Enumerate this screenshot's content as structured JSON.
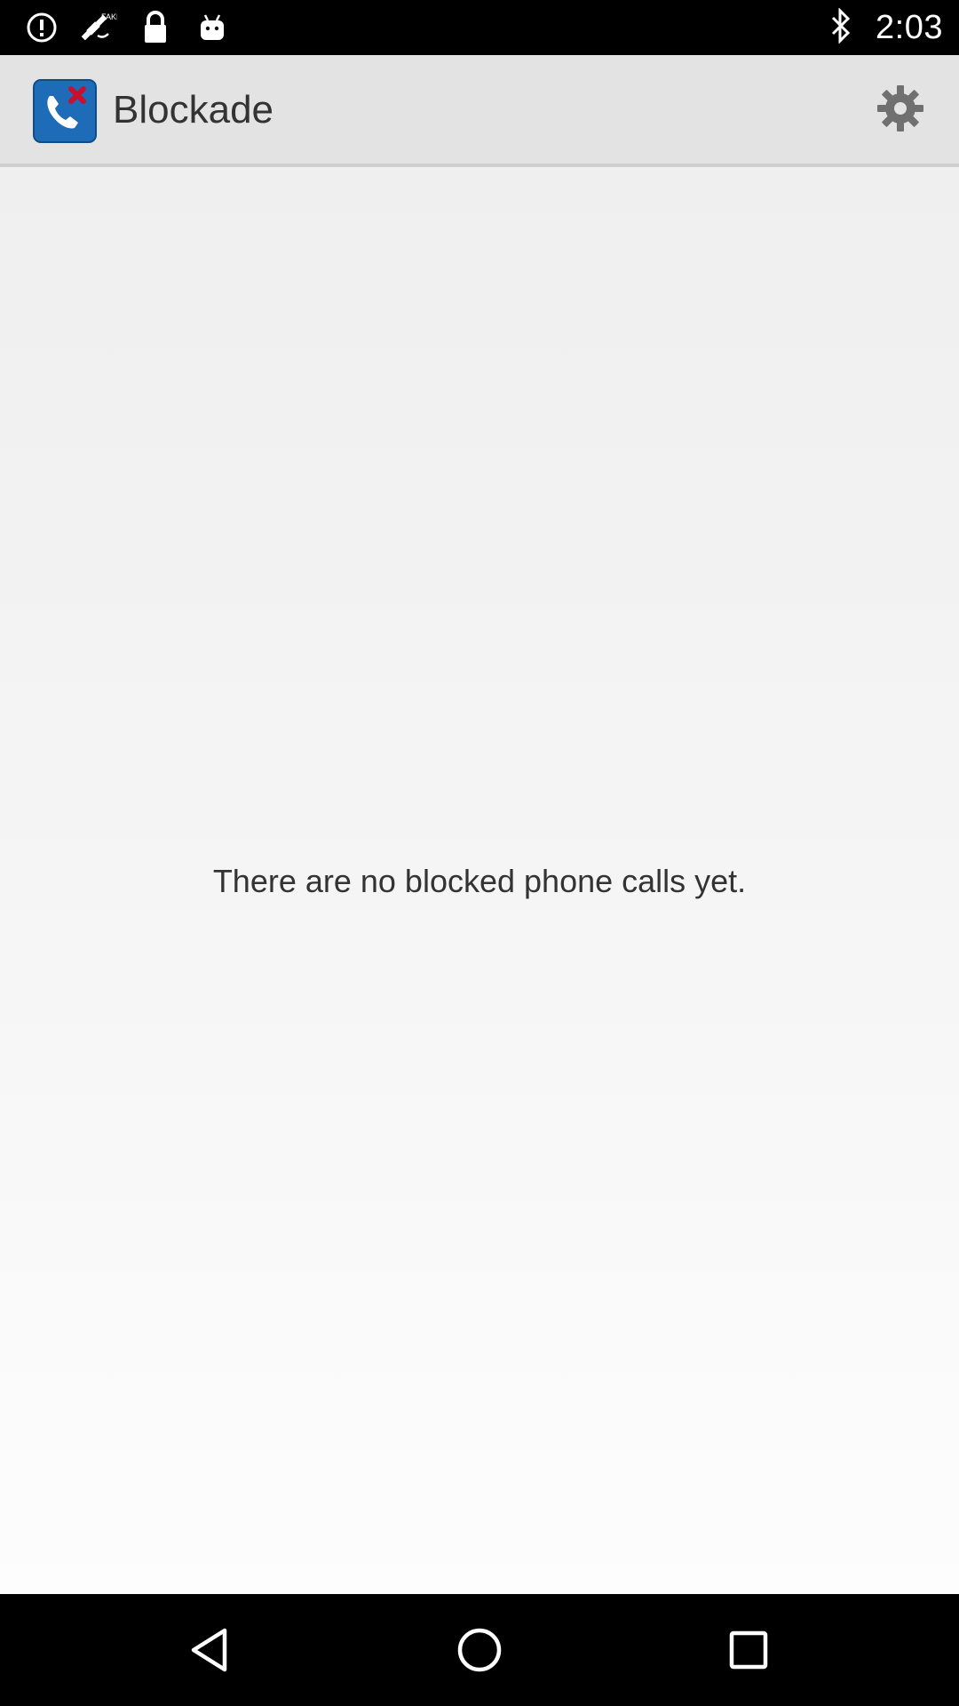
{
  "status_bar": {
    "time": "2:03",
    "icons": [
      "alert-icon",
      "satellite-fake-gps-icon",
      "lock-icon",
      "android-icon",
      "bluetooth-icon"
    ]
  },
  "app_bar": {
    "title": "Blockade",
    "logo_icon": "blocked-phone-logo-icon",
    "settings_icon": "gear-icon"
  },
  "main": {
    "empty_message": "There are no blocked phone calls yet."
  },
  "nav_bar": {
    "icons": [
      "back-icon",
      "home-icon",
      "recents-icon"
    ]
  },
  "colors": {
    "app_bar_bg": "#e3e3e3",
    "logo_blue": "#1e6bb8",
    "logo_red": "#c8102e",
    "text": "#333333"
  }
}
